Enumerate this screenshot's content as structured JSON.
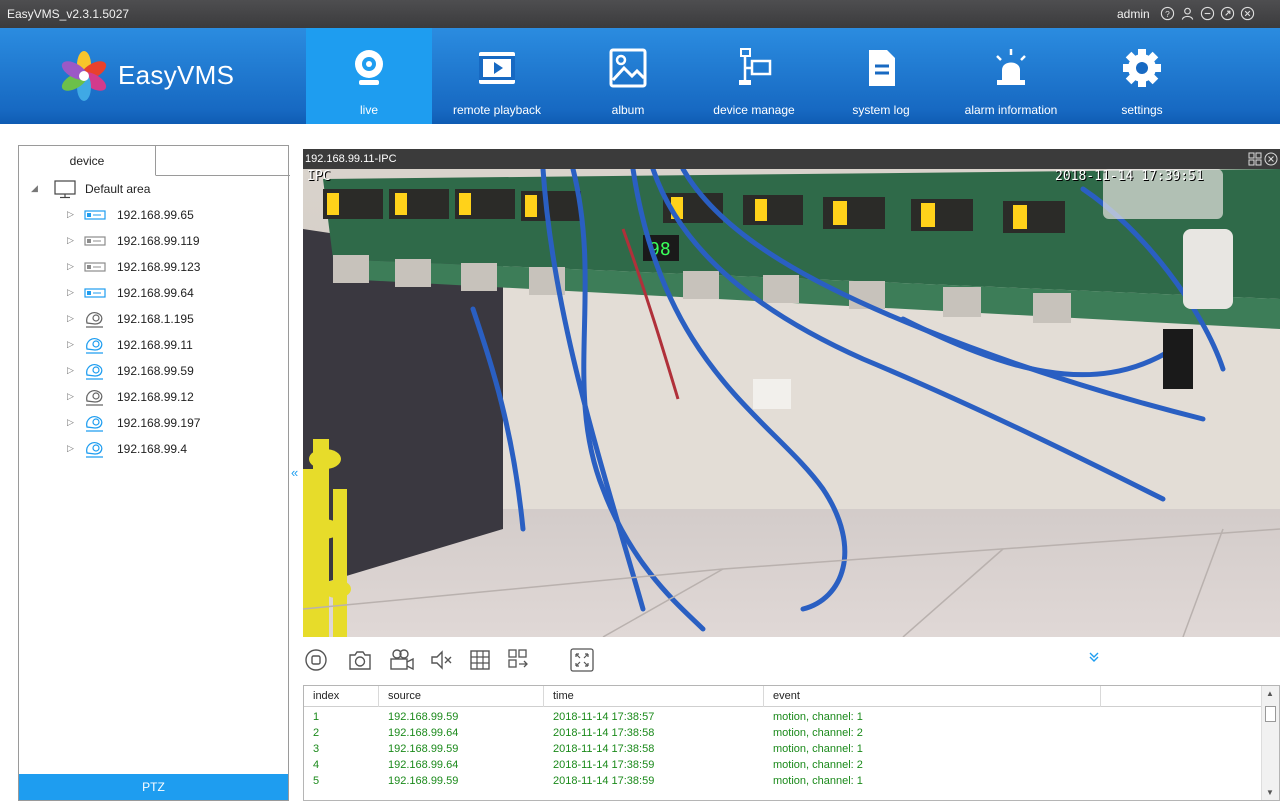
{
  "titlebar": {
    "app_title": "EasyVMS_v2.3.1.5027",
    "user": "admin",
    "icons": [
      "help-icon",
      "user-icon",
      "minimize-icon",
      "maximize-icon",
      "close-icon"
    ]
  },
  "brand": {
    "name": "EasyVMS"
  },
  "nav": [
    {
      "label": "live",
      "icon": "webcam-icon",
      "active": true
    },
    {
      "label": "remote playback",
      "icon": "playback-icon",
      "active": false
    },
    {
      "label": "album",
      "icon": "album-icon",
      "active": false
    },
    {
      "label": "device manage",
      "icon": "device-manage-icon",
      "active": false
    },
    {
      "label": "system log",
      "icon": "system-log-icon",
      "active": false
    },
    {
      "label": "alarm information",
      "icon": "alarm-icon",
      "active": false
    },
    {
      "label": "settings",
      "icon": "settings-icon",
      "active": false
    }
  ],
  "left_panel": {
    "tab": "device",
    "root": "Default area",
    "devices": [
      {
        "ip": "192.168.99.65",
        "type": "nvr",
        "online": true
      },
      {
        "ip": "192.168.99.119",
        "type": "nvr",
        "online": false
      },
      {
        "ip": "192.168.99.123",
        "type": "nvr",
        "online": false
      },
      {
        "ip": "192.168.99.64",
        "type": "nvr",
        "online": true
      },
      {
        "ip": "192.168.1.195",
        "type": "camera",
        "online": false
      },
      {
        "ip": "192.168.99.11",
        "type": "camera",
        "online": true
      },
      {
        "ip": "192.168.99.59",
        "type": "camera",
        "online": true
      },
      {
        "ip": "192.168.99.12",
        "type": "camera",
        "online": false
      },
      {
        "ip": "192.168.99.197",
        "type": "camera",
        "online": true
      },
      {
        "ip": "192.168.99.4",
        "type": "camera",
        "online": true
      }
    ],
    "ptz_label": "PTZ",
    "collapse_glyph": "«"
  },
  "video": {
    "title": "192.168.99.11-IPC",
    "osd_channel": "IPC",
    "osd_timestamp": "2018-11-14 17:39:51"
  },
  "toolbar": {
    "tools": [
      "stop-icon",
      "snapshot-icon",
      "record-icon",
      "mute-icon",
      "grid-icon",
      "layout-icon",
      "fullscreen-icon"
    ],
    "expand_glyph": "≫"
  },
  "events": {
    "columns": [
      "index",
      "source",
      "time",
      "event"
    ],
    "rows": [
      {
        "index": "1",
        "source": "192.168.99.59",
        "time": "2018-11-14 17:38:57",
        "event": "motion, channel: 1"
      },
      {
        "index": "2",
        "source": "192.168.99.64",
        "time": "2018-11-14 17:38:58",
        "event": "motion, channel: 2"
      },
      {
        "index": "3",
        "source": "192.168.99.59",
        "time": "2018-11-14 17:38:58",
        "event": "motion, channel: 1"
      },
      {
        "index": "4",
        "source": "192.168.99.64",
        "time": "2018-11-14 17:38:59",
        "event": "motion, channel: 2"
      },
      {
        "index": "5",
        "source": "192.168.99.59",
        "time": "2018-11-14 17:38:59",
        "event": "motion, channel: 1"
      }
    ]
  },
  "colors": {
    "header_blue": "#1769c2",
    "active_blue": "#1e9df0",
    "event_green": "#1b8a1b",
    "titlebar": "#3b3b3d"
  }
}
